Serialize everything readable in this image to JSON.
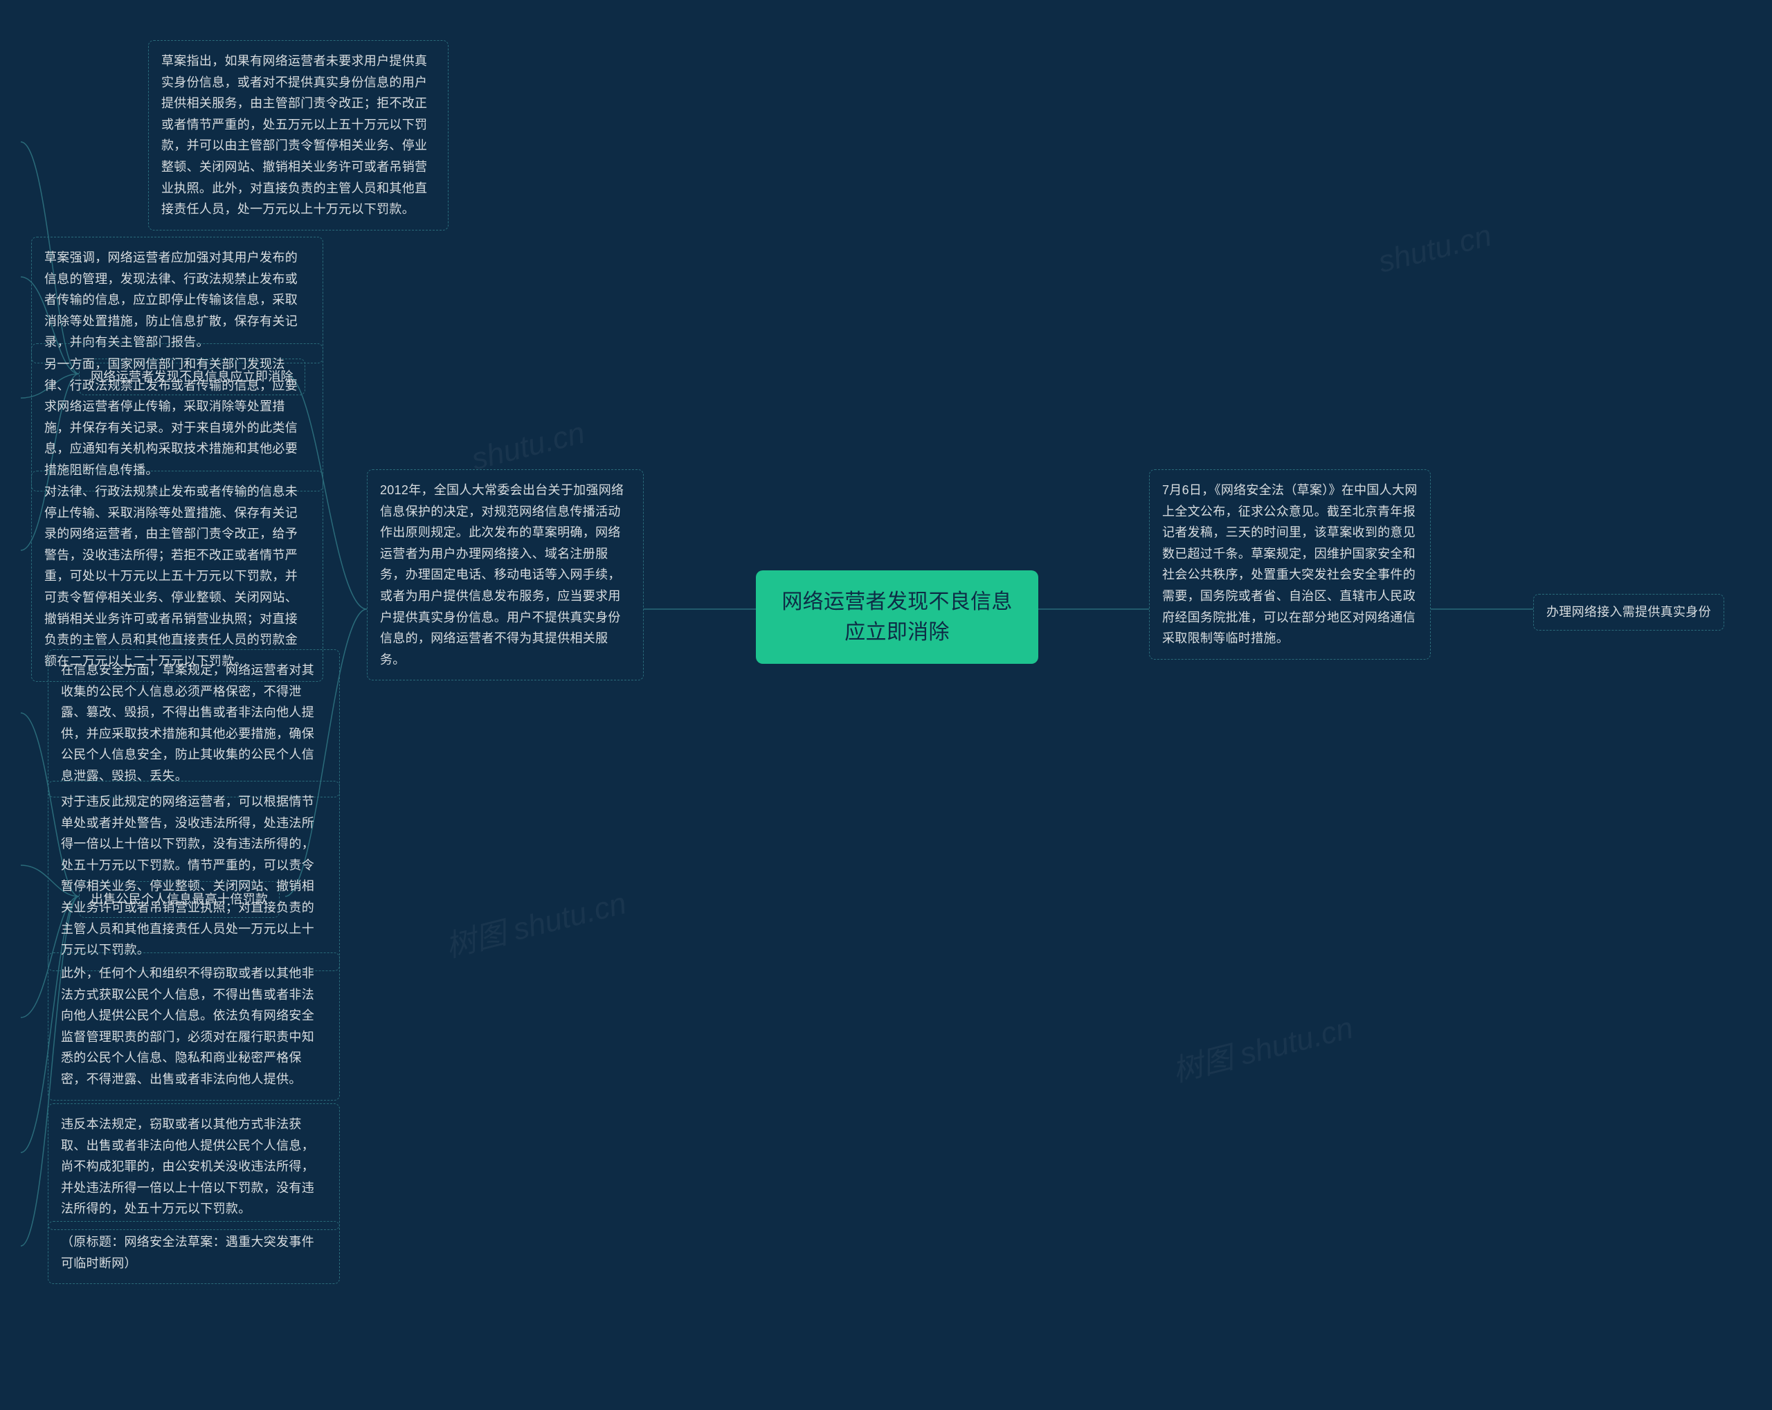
{
  "center": {
    "line1": "网络运营者发现不良信息",
    "line2": "应立即消除"
  },
  "right_intro": "7月6日，《网络安全法（草案）》在中国人大网上全文公布，征求公众意见。截至北京青年报记者发稿，三天的时间里，该草案收到的意见数已超过千条。草案规定，因维护国家安全和社会公共秩序，处置重大突发社会安全事件的需要，国务院或者省、自治区、直辖市人民政府经国务院批准，可以在部分地区对网络通信采取限制等临时措施。",
  "right_id": "办理网络接入需提供真实身份",
  "left_intro": "2012年，全国人大常委会出台关于加强网络信息保护的决定，对规范网络信息传播活动作出原则规定。此次发布的草案明确，网络运营者为用户办理网络接入、域名注册服务，办理固定电话、移动电话等入网手续，或者为用户提供信息发布服务，应当要求用户提供真实身份信息。用户不提供真实身份信息的，网络运营者不得为其提供相关服务。",
  "b1_title": "网络运营者发现不良信息应立即消除",
  "b1_items": [
    "草案指出，如果有网络运营者未要求用户提供真实身份信息，或者对不提供真实身份信息的用户提供相关服务，由主管部门责令改正；拒不改正或者情节严重的，处五万元以上五十万元以下罚款，并可以由主管部门责令暂停相关业务、停业整顿、关闭网站、撤销相关业务许可或者吊销营业执照。此外，对直接负责的主管人员和其他直接责任人员，处一万元以上十万元以下罚款。",
    "草案强调，网络运营者应加强对其用户发布的信息的管理，发现法律、行政法规禁止发布或者传输的信息，应立即停止传输该信息，采取消除等处置措施，防止信息扩散，保存有关记录，并向有关主管部门报告。",
    "另一方面，国家网信部门和有关部门发现法律、行政法规禁止发布或者传输的信息，应要求网络运营者停止传输，采取消除等处置措施，并保存有关记录。对于来自境外的此类信息，应通知有关机构采取技术措施和其他必要措施阻断信息传播。",
    "对法律、行政法规禁止发布或者传输的信息未停止传输、采取消除等处置措施、保存有关记录的网络运营者，由主管部门责令改正，给予警告，没收违法所得；若拒不改正或者情节严重，可处以十万元以上五十万元以下罚款，并可责令暂停相关业务、停业整顿、关闭网站、撤销相关业务许可或者吊销营业执照；对直接负责的主管人员和其他直接责任人员的罚款金额在二万元以上二十万元以下罚款。"
  ],
  "b2_title": "出售公民个人信息最高十倍罚款",
  "b2_items": [
    "在信息安全方面，草案规定，网络运营者对其收集的公民个人信息必须严格保密，不得泄露、篡改、毁损，不得出售或者非法向他人提供，并应采取技术措施和其他必要措施，确保公民个人信息安全，防止其收集的公民个人信息泄露、毁损、丢失。",
    "对于违反此规定的网络运营者，可以根据情节单处或者并处警告，没收违法所得，处违法所得一倍以上十倍以下罚款，没有违法所得的，处五十万元以下罚款。情节严重的，可以责令暂停相关业务、停业整顿、关闭网站、撤销相关业务许可或者吊销营业执照；对直接负责的主管人员和其他直接责任人员处一万元以上十万元以下罚款。",
    "此外，任何个人和组织不得窃取或者以其他非法方式获取公民个人信息，不得出售或者非法向他人提供公民个人信息。依法负有网络安全监督管理职责的部门，必须对在履行职责中知悉的公民个人信息、隐私和商业秘密严格保密，不得泄露、出售或者非法向他人提供。",
    "违反本法规定，窃取或者以其他方式非法获取、出售或者非法向他人提供公民个人信息，尚不构成犯罪的，由公安机关没收违法所得，并处违法所得一倍以上十倍以下罚款，没有违法所得的，处五十万元以下罚款。",
    "（原标题：网络安全法草案：遇重大突发事件可临时断网）"
  ],
  "watermark": "树图 shutu.cn",
  "watermark_short": "shutu.cn"
}
